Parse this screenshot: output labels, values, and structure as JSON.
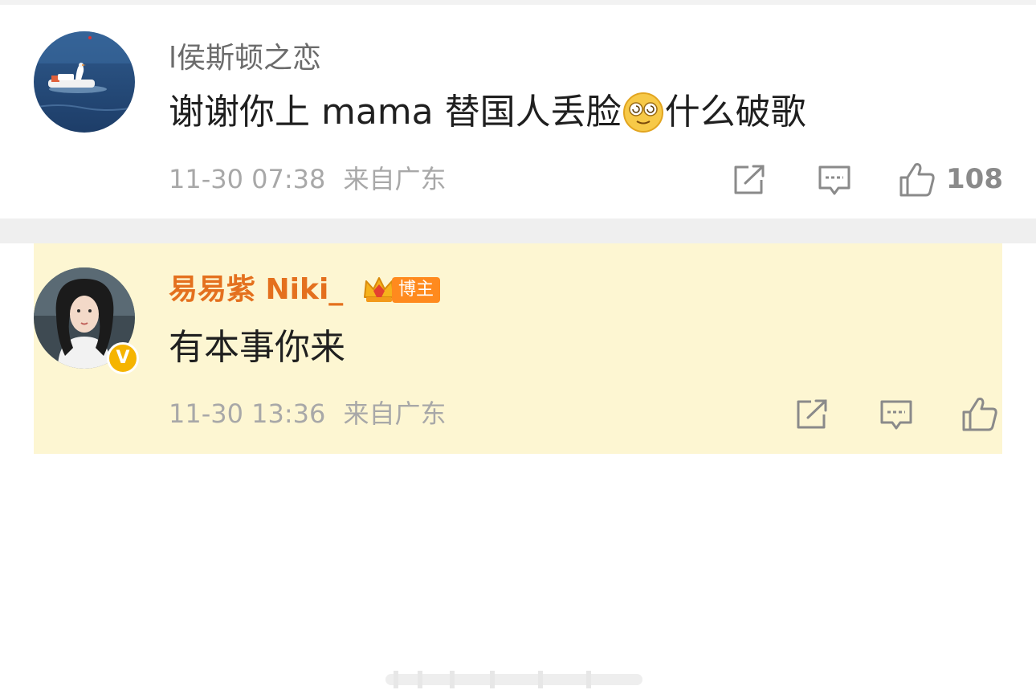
{
  "comments": [
    {
      "username": "l侯斯顿之恋",
      "text_before_emoji": "谢谢你上 mama 替国人丢脸",
      "emoji": "dizzy-face-emoji",
      "text_after_emoji": "什么破歌",
      "timestamp": "11-30 07:38",
      "location": "来自广东",
      "like_count": "108",
      "avatar": "avatar-swan-boat-on-water"
    },
    {
      "username": "易易紫 Niki_",
      "badge_label": "博主",
      "text": "有本事你来",
      "timestamp": "11-30 13:36",
      "location": "来自广东",
      "verified": true,
      "avatar": "avatar-woman-dark-hair",
      "highlight_color": "#fdf6d2",
      "username_color": "#e4701e"
    }
  ],
  "icons": {
    "share": "share-icon",
    "reply": "comment-icon",
    "like": "thumbs-up-icon"
  }
}
